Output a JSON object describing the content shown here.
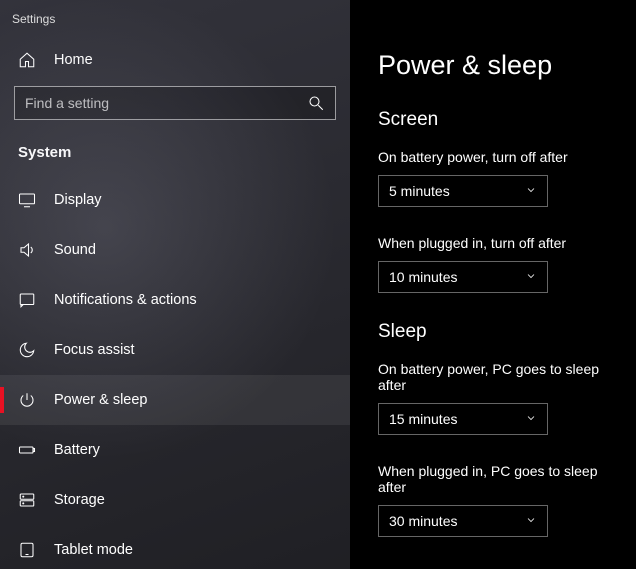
{
  "window_title": "Settings",
  "home_label": "Home",
  "search": {
    "placeholder": "Find a setting"
  },
  "section_title": "System",
  "nav": [
    {
      "label": "Display",
      "icon": "display-icon",
      "active": false
    },
    {
      "label": "Sound",
      "icon": "sound-icon",
      "active": false
    },
    {
      "label": "Notifications & actions",
      "icon": "notifications-icon",
      "active": false
    },
    {
      "label": "Focus assist",
      "icon": "focus-icon",
      "active": false
    },
    {
      "label": "Power & sleep",
      "icon": "power-icon",
      "active": true
    },
    {
      "label": "Battery",
      "icon": "battery-icon",
      "active": false
    },
    {
      "label": "Storage",
      "icon": "storage-icon",
      "active": false
    },
    {
      "label": "Tablet mode",
      "icon": "tablet-icon",
      "active": false
    }
  ],
  "main": {
    "title": "Power & sleep",
    "groups": [
      {
        "title": "Screen",
        "fields": [
          {
            "label": "On battery power, turn off after",
            "value": "5 minutes"
          },
          {
            "label": "When plugged in, turn off after",
            "value": "10 minutes"
          }
        ]
      },
      {
        "title": "Sleep",
        "fields": [
          {
            "label": "On battery power, PC goes to sleep after",
            "value": "15 minutes"
          },
          {
            "label": "When plugged in, PC goes to sleep after",
            "value": "30 minutes"
          }
        ]
      }
    ]
  }
}
